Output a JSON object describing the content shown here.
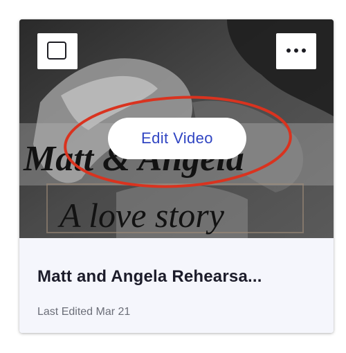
{
  "card": {
    "title": "Matt and Angela Rehearsa...",
    "last_edited": "Last Edited Mar 21",
    "edit_button_label": "Edit Video",
    "thumbnail": {
      "headline": "Matt & Angela",
      "tagline": "A love story"
    }
  },
  "colors": {
    "accent": "#2f44c2",
    "annotation": "#d9331f",
    "panel": "#f5f6fc"
  },
  "icons": {
    "select": "checkbox-icon",
    "more": "more-options-icon"
  }
}
